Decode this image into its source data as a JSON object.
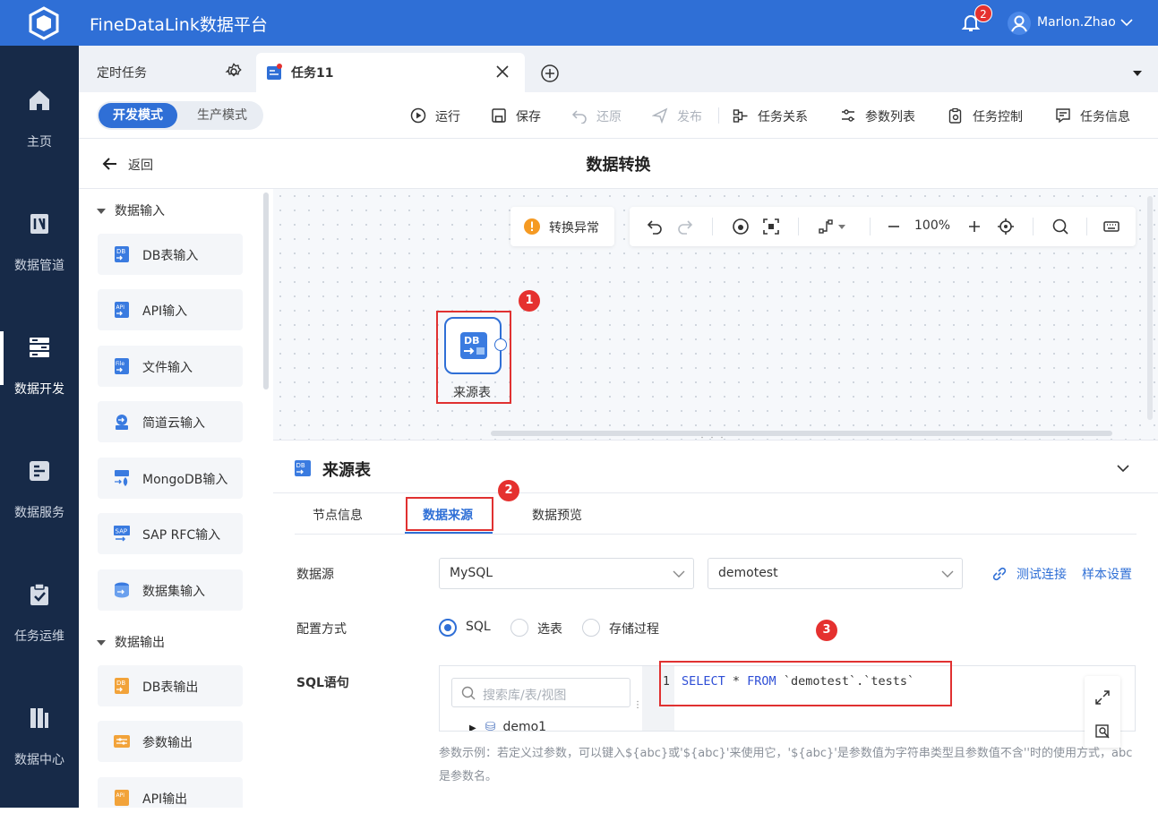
{
  "app": {
    "title": "FineDataLink数据平台",
    "notification_count": "2",
    "user": "Marlon.Zhao"
  },
  "nav": [
    {
      "label": "主页",
      "icon": "home-icon",
      "active": false
    },
    {
      "label": "数据管道",
      "icon": "pipeline-icon",
      "active": false
    },
    {
      "label": "数据开发",
      "icon": "dev-icon",
      "active": true
    },
    {
      "label": "数据服务",
      "icon": "service-icon",
      "active": false
    },
    {
      "label": "任务运维",
      "icon": "ops-icon",
      "active": false
    },
    {
      "label": "数据中心",
      "icon": "datacenter-icon",
      "active": false
    }
  ],
  "tabs": {
    "scheduled": "定时任务",
    "task": "任务11"
  },
  "toolbar": {
    "mode_dev": "开发模式",
    "mode_prod": "生产模式",
    "run": "运行",
    "save": "保存",
    "restore": "还原",
    "publish": "发布",
    "relations": "任务关系",
    "params": "参数列表",
    "control": "任务控制",
    "info": "任务信息"
  },
  "header": {
    "back": "返回",
    "title": "数据转换"
  },
  "components": {
    "input_section": "数据输入",
    "inputs": [
      "DB表输入",
      "API输入",
      "文件输入",
      "简道云输入",
      "MongoDB输入",
      "SAP RFC输入",
      "数据集输入"
    ],
    "output_section": "数据输出",
    "outputs": [
      "DB表输出",
      "参数输出",
      "API输出"
    ]
  },
  "canvas": {
    "warning": "转换异常",
    "zoom": "100%",
    "node_label": "来源表",
    "node_icon_text": "DB"
  },
  "markers": [
    "1",
    "2",
    "3"
  ],
  "panel": {
    "title": "来源表",
    "tabs": [
      "节点信息",
      "数据来源",
      "数据预览"
    ],
    "active_tab": "数据来源",
    "datasource_label": "数据源",
    "db_type": "MySQL",
    "db_name": "demotest",
    "test_link": "测试连接",
    "sample_link": "样本设置",
    "config_label": "配置方式",
    "config_options": [
      "SQL",
      "选表",
      "存储过程"
    ],
    "config_selected": "SQL",
    "sql_label": "SQL语句",
    "search_placeholder": "搜索库/表/视图",
    "tree_item": "demo1",
    "line_number": "1",
    "sql_kw1": "SELECT",
    "sql_mid": " * ",
    "sql_kw2": "FROM",
    "sql_rest": " `demotest`.`tests`",
    "hint": "参数示例：若定义过参数，可以键入${abc}或'${abc}'来使用它，'${abc}'是参数值为字符串类型且参数值不含''时的使用方式，abc是参数名。"
  }
}
